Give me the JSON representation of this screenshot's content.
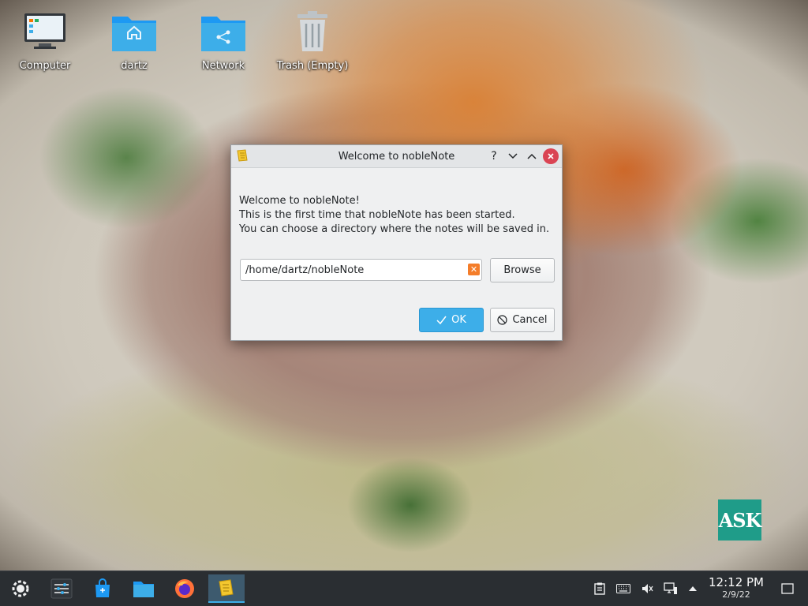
{
  "desktop": {
    "icons": [
      {
        "label": "Computer",
        "icon": "computer-icon"
      },
      {
        "label": "dartz",
        "icon": "home-folder-icon"
      },
      {
        "label": "Network",
        "icon": "network-folder-icon"
      },
      {
        "label": "Trash (Empty)",
        "icon": "trash-icon"
      }
    ],
    "watermark": "ASK"
  },
  "dialog": {
    "title": "Welcome to nobleNote",
    "message_line1": "Welcome to nobleNote!",
    "message_line2": "This is the first time that nobleNote has been started.",
    "message_line3": "You can choose a directory where the notes will be saved in.",
    "path_value": "/home/dartz/nobleNote",
    "browse_label": "Browse",
    "ok_label": "OK",
    "cancel_label": "Cancel",
    "title_controls": [
      "?",
      "minimize",
      "maximize",
      "close"
    ]
  },
  "taskbar": {
    "items": [
      "application-launcher-icon",
      "settings-panel-icon",
      "discover-store-icon",
      "file-manager-icon",
      "firefox-icon",
      "noblenote-icon"
    ],
    "tray": [
      "clipboard-icon",
      "keyboard-icon",
      "volume-muted-icon",
      "network-icon",
      "expand-tray-icon"
    ],
    "time": "12:12 PM",
    "date": "2/9/22"
  },
  "colors": {
    "accent": "#3daee9",
    "close": "#da4453",
    "taskbar": "#2a2e32"
  }
}
